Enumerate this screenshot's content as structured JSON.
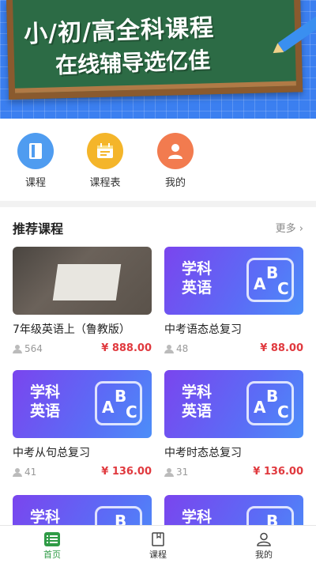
{
  "banner": {
    "title": "小/初/高全科课程",
    "subtitle": "在线辅导选亿佳"
  },
  "quicknav": [
    {
      "label": "课程",
      "icon": "book-icon",
      "color": "#4f9cf0"
    },
    {
      "label": "课程表",
      "icon": "schedule-icon",
      "color": "#f4b52a"
    },
    {
      "label": "我的",
      "icon": "user-icon",
      "color": "#f27b4f"
    }
  ],
  "recommend": {
    "title": "推荐课程",
    "more": "更多",
    "thumb_text": [
      "学科",
      "英语"
    ],
    "courses": [
      {
        "title": "7年级英语上（鲁教版）",
        "students": "564",
        "price": "¥ 888.00",
        "thumb": "photo"
      },
      {
        "title": "中考语态总复习",
        "students": "48",
        "price": "¥ 88.00",
        "thumb": "purple"
      },
      {
        "title": "中考从句总复习",
        "students": "41",
        "price": "¥ 136.00",
        "thumb": "purple"
      },
      {
        "title": "中考时态总复习",
        "students": "31",
        "price": "¥ 136.00",
        "thumb": "purple"
      },
      {
        "title": "",
        "students": "",
        "price": "",
        "thumb": "purple"
      },
      {
        "title": "",
        "students": "",
        "price": "",
        "thumb": "purple"
      }
    ]
  },
  "tabbar": [
    {
      "label": "首页",
      "icon": "home-icon",
      "active": true
    },
    {
      "label": "课程",
      "icon": "course-icon",
      "active": false
    },
    {
      "label": "我的",
      "icon": "profile-icon",
      "active": false
    }
  ],
  "colors": {
    "accent": "#2f9b46",
    "price": "#e0393e"
  }
}
